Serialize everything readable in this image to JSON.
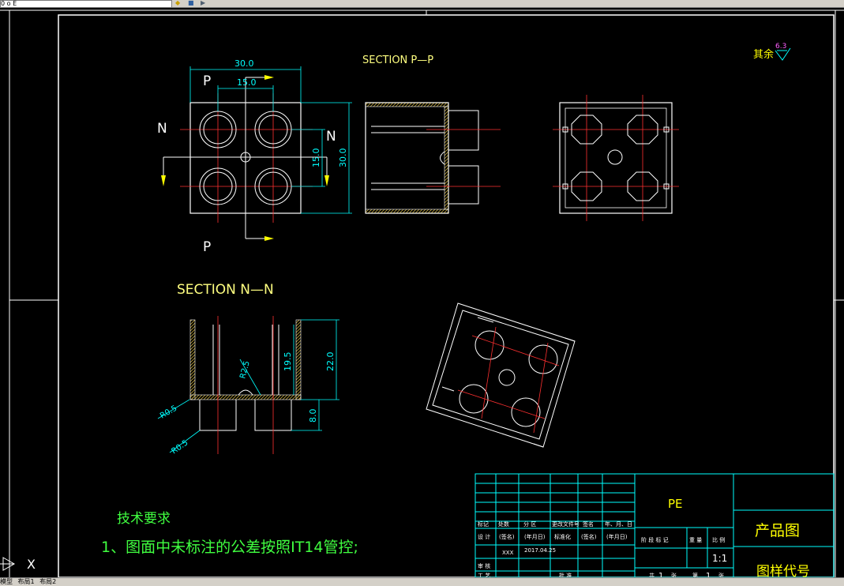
{
  "toolbar": {
    "layer_value": "0 o E"
  },
  "drawing": {
    "roughness_label": "其余",
    "roughness_value": "6.3",
    "section_pp": "SECTION  P—P",
    "section_nn": "SECTION  N—N",
    "label_p": "P",
    "label_n": "N",
    "dims": {
      "d30_top": "30.0",
      "d15_top": "15.0",
      "d15_side": "15.0",
      "d30_side": "30.0",
      "d22": "22.0",
      "d19_5": "19.5",
      "d8": "8.0",
      "r2_5": "R2.5",
      "r0_5a": "R0.5",
      "r0_5b": "R0.5"
    },
    "tech_title": "技术要求",
    "tech_line1": "1、图面中未标注的公差按照IT14管控;"
  },
  "title_block": {
    "col_mark": "标记",
    "col_count": "处数",
    "col_zone": "分 区",
    "col_docno": "更改文件号",
    "col_sign": "签名",
    "col_date": "年、月、日",
    "row_design": "设 计",
    "sign_ph": "(签名)",
    "date_ph": "(年月日)",
    "std": "标准化",
    "sign_ph2": "(签名)",
    "date_ph2": "(年月日)",
    "designer": "XXX",
    "design_date": "2017.04.25",
    "row_review": "审 核",
    "row_process": "工 艺",
    "approve": "批 准",
    "stage_mark": "阶 段 标 记",
    "weight": "重 量",
    "scale": "比 例",
    "scale_value": "1:1",
    "sheet_a": "共",
    "sheet_one": "1",
    "sheet_b": "张",
    "sheet_c": "第",
    "sheet_d": "张",
    "material": "PE",
    "product": "产品图",
    "code": "图样代号"
  },
  "statusbar": {
    "layout1": "模型",
    "layout2": "布局1",
    "layout3": "布局2"
  },
  "ucs": {
    "x_label": "X"
  }
}
